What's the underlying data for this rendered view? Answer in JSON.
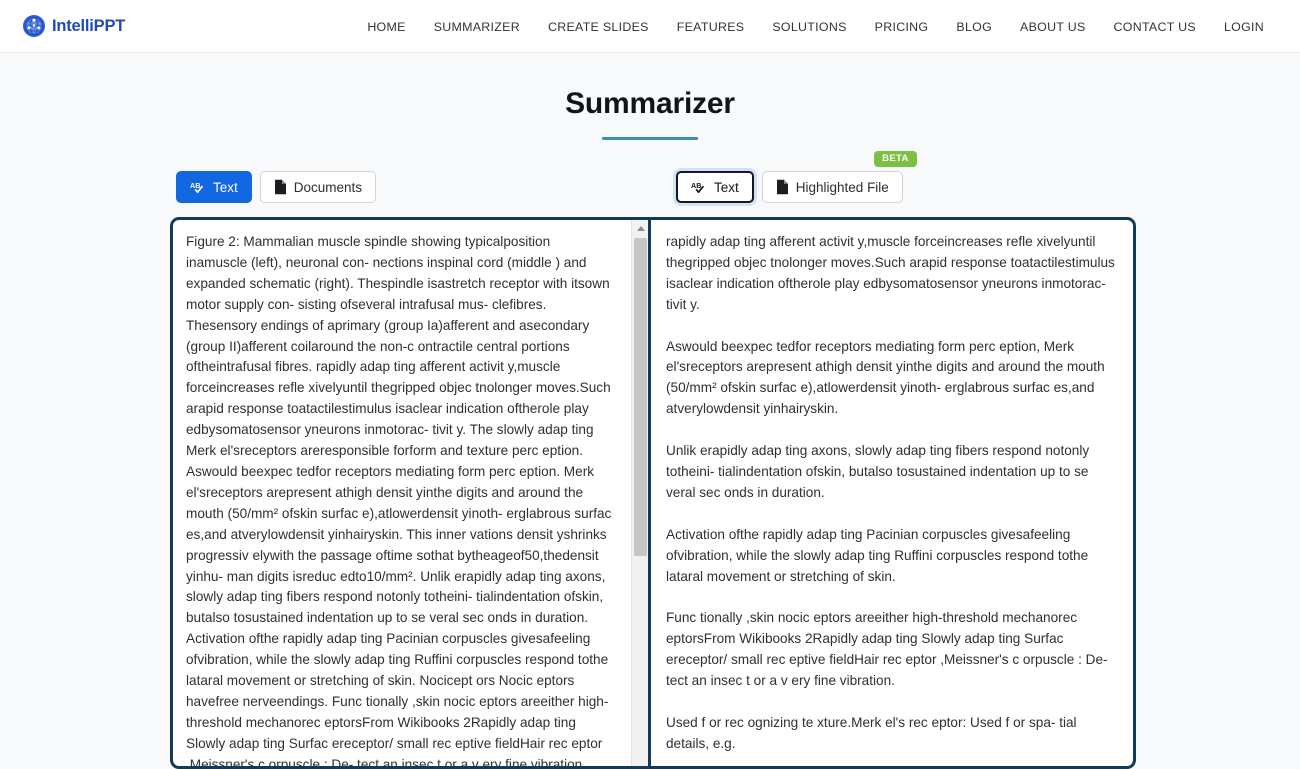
{
  "header": {
    "brand": "IntelliPPT",
    "brand_icon": "globe-network-icon",
    "brand_color": "#1f4bb8",
    "nav": [
      {
        "label": "HOME"
      },
      {
        "label": "SUMMARIZER"
      },
      {
        "label": "CREATE SLIDES"
      },
      {
        "label": "FEATURES"
      },
      {
        "label": "SOLUTIONS"
      },
      {
        "label": "PRICING"
      },
      {
        "label": "BLOG"
      },
      {
        "label": "ABOUT US"
      },
      {
        "label": "CONTACT US"
      },
      {
        "label": "LOGIN"
      }
    ]
  },
  "page": {
    "title": "Summarizer",
    "rule_color": "#3d8fb4"
  },
  "input_tabs": {
    "items": [
      {
        "label": "Text",
        "icon": "spellcheck-ab-icon",
        "active": true
      },
      {
        "label": "Documents",
        "icon": "file-document-icon",
        "active": false
      }
    ],
    "active_color": "#1268e3"
  },
  "output_tabs": {
    "items": [
      {
        "label": "Text",
        "icon": "spellcheck-ab-icon",
        "active": true
      },
      {
        "label": "Highlighted File",
        "icon": "file-document-icon",
        "active": false
      }
    ],
    "badge": "BETA",
    "badge_color": "#7bc043"
  },
  "input_panel": {
    "text": "Figure 2: Mammalian muscle spindle showing typicalposition inamuscle (left), neuronal con- nections inspinal cord (middle ) and expanded schematic (right). Thespindle isastretch receptor with itsown motor supply con- sisting ofseveral intrafusal mus- clefibres. Thesensory endings of aprimary (group Ia)afferent and asecondary (group II)afferent coilaround the non-c ontractile central portions oftheintrafusal fibres. rapidly adap ting afferent activit y,muscle forceincreases refle xivelyuntil thegripped objec tnolonger moves.Such arapid response toatactilestimulus isaclear indication oftherole play edbysomatosensor yneurons inmotorac- tivit y. The slowly adap ting Merk el'sreceptors areresponsible forform and texture perc eption. Aswould beexpec tedfor receptors mediating form perc eption. Merk el'sreceptors arepresent athigh densit yinthe digits and around the mouth (50/mm² ofskin surfac e),atlowerdensit yinoth- erglabrous surfac es,and atverylowdensit yinhairyskin. This inner vations densit yshrinks progressiv elywith the passage oftime sothat bytheageof50,thedensit yinhu- man digits isreduc edto10/mm². Unlik erapidly adap ting axons, slowly adap ting fibers respond notonly totheini- tialindentation ofskin, butalso tosustained indentation up to se veral sec onds in duration. Activation ofthe rapidly adap ting Pacinian corpuscles givesafeeling ofvibration, while the slowly adap ting Ruffini corpuscles respond tothe lataral movement or stretching of skin. Nocicept ors Nocic eptors havefree nerveendings. Func tionally ,skin nocic eptors areeither high-threshold mechanorec eptorsFrom Wikibooks 2Rapidly adap ting Slowly adap ting Surfac ereceptor/ small rec eptive fieldHair rec eptor ,Meissner's c orpuscle : De- tect an insec t or a v ery fine vibration. Used",
    "scrollbar": {
      "visible": true,
      "up_arrow": "scroll-up-arrow-icon"
    }
  },
  "output_panel": {
    "text": "rapidly adap ting afferent activit y,muscle forceincreases refle xivelyuntil thegripped objec tnolonger moves.Such arapid response toatactilestimulus isaclear indication oftherole play edbysomatosensor yneurons inmotorac- tivit y.\n\nAswould beexpec tedfor receptors mediating form perc eption, Merk el'sreceptors arepresent athigh densit yinthe digits and around the mouth (50/mm² ofskin surfac e),atlowerdensit yinoth- erglabrous surfac es,and atverylowdensit yinhairyskin.\n\nUnlik erapidly adap ting axons, slowly adap ting fibers respond notonly totheini- tialindentation ofskin, butalso tosustained indentation up to se veral sec onds in duration.\n\nActivation ofthe rapidly adap ting Pacinian corpuscles givesafeeling ofvibration, while the slowly adap ting Ruffini corpuscles respond tothe lataral movement or stretching of skin.\n\nFunc tionally ,skin nocic eptors areeither high-threshold mechanorec eptorsFrom Wikibooks 2Rapidly adap ting Slowly adap ting Surfac ereceptor/ small rec eptive fieldHair rec eptor ,Meissner's c orpuscle : De- tect an insec t or a v ery fine vibration.\n\nUsed f or rec ognizing te xture.Merk el's rec eptor: Used f or spa- tial details, e.g."
  }
}
